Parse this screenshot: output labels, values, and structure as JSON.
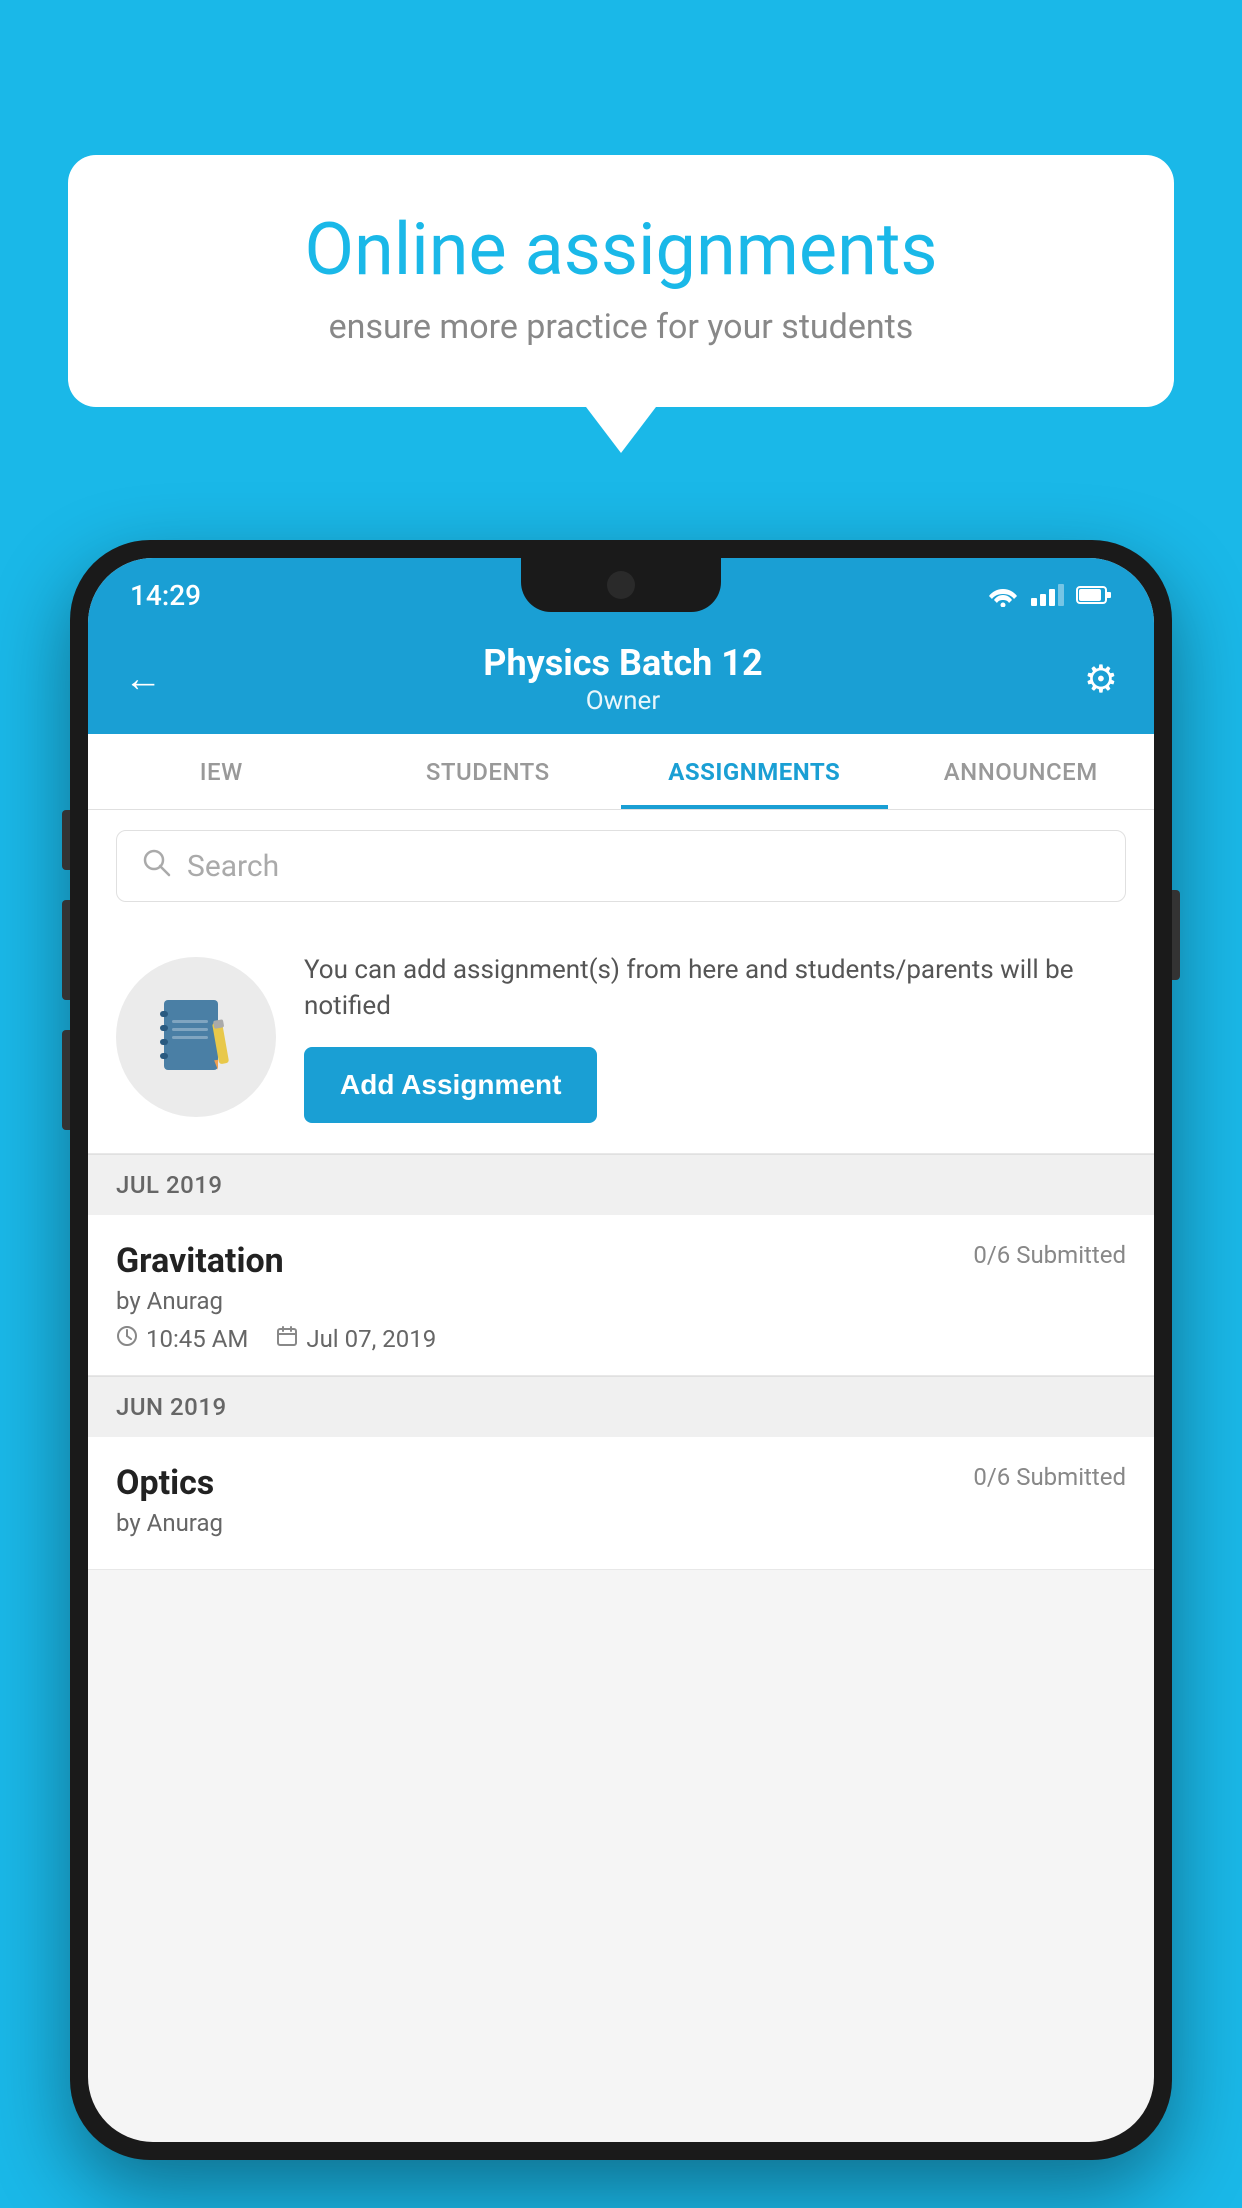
{
  "background_color": "#1ab8e8",
  "speech_bubble": {
    "title": "Online assignments",
    "subtitle": "ensure more practice for your students"
  },
  "status_bar": {
    "time": "14:29",
    "wifi": "▼",
    "battery": "▮"
  },
  "app_header": {
    "title": "Physics Batch 12",
    "subtitle": "Owner",
    "back_label": "←",
    "settings_label": "⚙"
  },
  "tabs": [
    {
      "label": "IEW",
      "active": false
    },
    {
      "label": "STUDENTS",
      "active": false
    },
    {
      "label": "ASSIGNMENTS",
      "active": true
    },
    {
      "label": "ANNOUNCEM",
      "active": false
    }
  ],
  "search": {
    "placeholder": "Search"
  },
  "info_card": {
    "description": "You can add assignment(s) from here and students/parents will be notified",
    "add_button_label": "Add Assignment"
  },
  "sections": [
    {
      "month_label": "JUL 2019",
      "assignments": [
        {
          "title": "Gravitation",
          "submitted": "0/6 Submitted",
          "author": "by Anurag",
          "time": "10:45 AM",
          "date": "Jul 07, 2019"
        }
      ]
    },
    {
      "month_label": "JUN 2019",
      "assignments": [
        {
          "title": "Optics",
          "submitted": "0/6 Submitted",
          "author": "by Anurag",
          "time": "",
          "date": ""
        }
      ]
    }
  ]
}
